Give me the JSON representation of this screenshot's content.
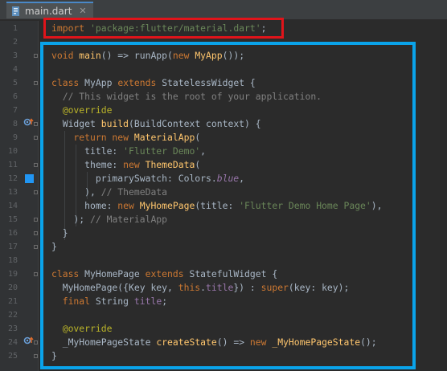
{
  "tab": {
    "filename": "main.dart",
    "close": "✕"
  },
  "gutter": {
    "markers": [
      {
        "line": 8,
        "icon": "override-marker-icon"
      },
      {
        "line": 12,
        "icon": "color-swatch-icon",
        "color": "#2196f3"
      },
      {
        "line": 24,
        "icon": "override-marker-icon"
      }
    ]
  },
  "annotations": {
    "red_box_color": "#e0141a",
    "blue_box_color": "#0aa3ea"
  },
  "lines": [
    {
      "n": "1",
      "tokens": [
        [
          "k",
          "import "
        ],
        [
          "s",
          "'package:flutter/material.dart'"
        ],
        [
          "d",
          ";"
        ]
      ]
    },
    {
      "n": "2",
      "tokens": []
    },
    {
      "n": "3",
      "tokens": [
        [
          "k",
          "void "
        ],
        [
          "fn",
          "main"
        ],
        [
          "d",
          "() => runApp("
        ],
        [
          "k",
          "new "
        ],
        [
          "fn",
          "MyApp"
        ],
        [
          "d",
          "());"
        ]
      ]
    },
    {
      "n": "4",
      "tokens": []
    },
    {
      "n": "5",
      "tokens": [
        [
          "k",
          "class "
        ],
        [
          "d",
          "MyApp "
        ],
        [
          "k",
          "extends "
        ],
        [
          "d",
          "StatelessWidget {"
        ]
      ]
    },
    {
      "n": "6",
      "tokens": [
        [
          "c",
          "  // This widget is the root of your application."
        ]
      ]
    },
    {
      "n": "7",
      "tokens": [
        [
          "an",
          "  @override"
        ]
      ]
    },
    {
      "n": "8",
      "tokens": [
        [
          "d",
          "  Widget "
        ],
        [
          "fn",
          "build"
        ],
        [
          "d",
          "(BuildContext context) {"
        ]
      ]
    },
    {
      "n": "9",
      "tokens": [
        [
          "k",
          "    return new "
        ],
        [
          "fn",
          "MaterialApp"
        ],
        [
          "d",
          "("
        ]
      ]
    },
    {
      "n": "10",
      "tokens": [
        [
          "d",
          "      title: "
        ],
        [
          "s",
          "'Flutter Demo'"
        ],
        [
          "d",
          ","
        ]
      ]
    },
    {
      "n": "11",
      "tokens": [
        [
          "d",
          "      theme: "
        ],
        [
          "k",
          "new "
        ],
        [
          "fn",
          "ThemeData"
        ],
        [
          "d",
          "("
        ]
      ]
    },
    {
      "n": "12",
      "tokens": [
        [
          "d",
          "        primarySwatch: Colors."
        ],
        [
          "it",
          "blue"
        ],
        [
          "d",
          ","
        ]
      ]
    },
    {
      "n": "13",
      "tokens": [
        [
          "d",
          "      ), "
        ],
        [
          "c",
          "// ThemeData"
        ]
      ]
    },
    {
      "n": "14",
      "tokens": [
        [
          "d",
          "      home: "
        ],
        [
          "k",
          "new "
        ],
        [
          "fn",
          "MyHomePage"
        ],
        [
          "d",
          "(title: "
        ],
        [
          "s",
          "'Flutter Demo Home Page'"
        ],
        [
          "d",
          "),"
        ]
      ]
    },
    {
      "n": "15",
      "tokens": [
        [
          "d",
          "    ); "
        ],
        [
          "c",
          "// MaterialApp"
        ]
      ]
    },
    {
      "n": "16",
      "tokens": [
        [
          "d",
          "  }"
        ]
      ]
    },
    {
      "n": "17",
      "tokens": [
        [
          "d",
          "}"
        ]
      ]
    },
    {
      "n": "18",
      "tokens": []
    },
    {
      "n": "19",
      "tokens": [
        [
          "k",
          "class "
        ],
        [
          "d",
          "MyHomePage "
        ],
        [
          "k",
          "extends "
        ],
        [
          "d",
          "StatefulWidget {"
        ]
      ]
    },
    {
      "n": "20",
      "tokens": [
        [
          "d",
          "  MyHomePage({Key key, "
        ],
        [
          "k",
          "this"
        ],
        [
          "d",
          "."
        ],
        [
          "pp",
          "title"
        ],
        [
          "d",
          "}) : "
        ],
        [
          "k",
          "super"
        ],
        [
          "d",
          "(key: key);"
        ]
      ]
    },
    {
      "n": "21",
      "tokens": [
        [
          "k",
          "  final "
        ],
        [
          "d",
          "String "
        ],
        [
          "pp",
          "title"
        ],
        [
          "d",
          ";"
        ]
      ]
    },
    {
      "n": "22",
      "tokens": []
    },
    {
      "n": "23",
      "tokens": [
        [
          "an",
          "  @override"
        ]
      ]
    },
    {
      "n": "24",
      "tokens": [
        [
          "d",
          "  _MyHomePageState "
        ],
        [
          "fn",
          "createState"
        ],
        [
          "d",
          "() => "
        ],
        [
          "k",
          "new "
        ],
        [
          "fn",
          "_MyHomePageState"
        ],
        [
          "d",
          "();"
        ]
      ]
    },
    {
      "n": "25",
      "tokens": [
        [
          "d",
          "}"
        ]
      ]
    }
  ]
}
